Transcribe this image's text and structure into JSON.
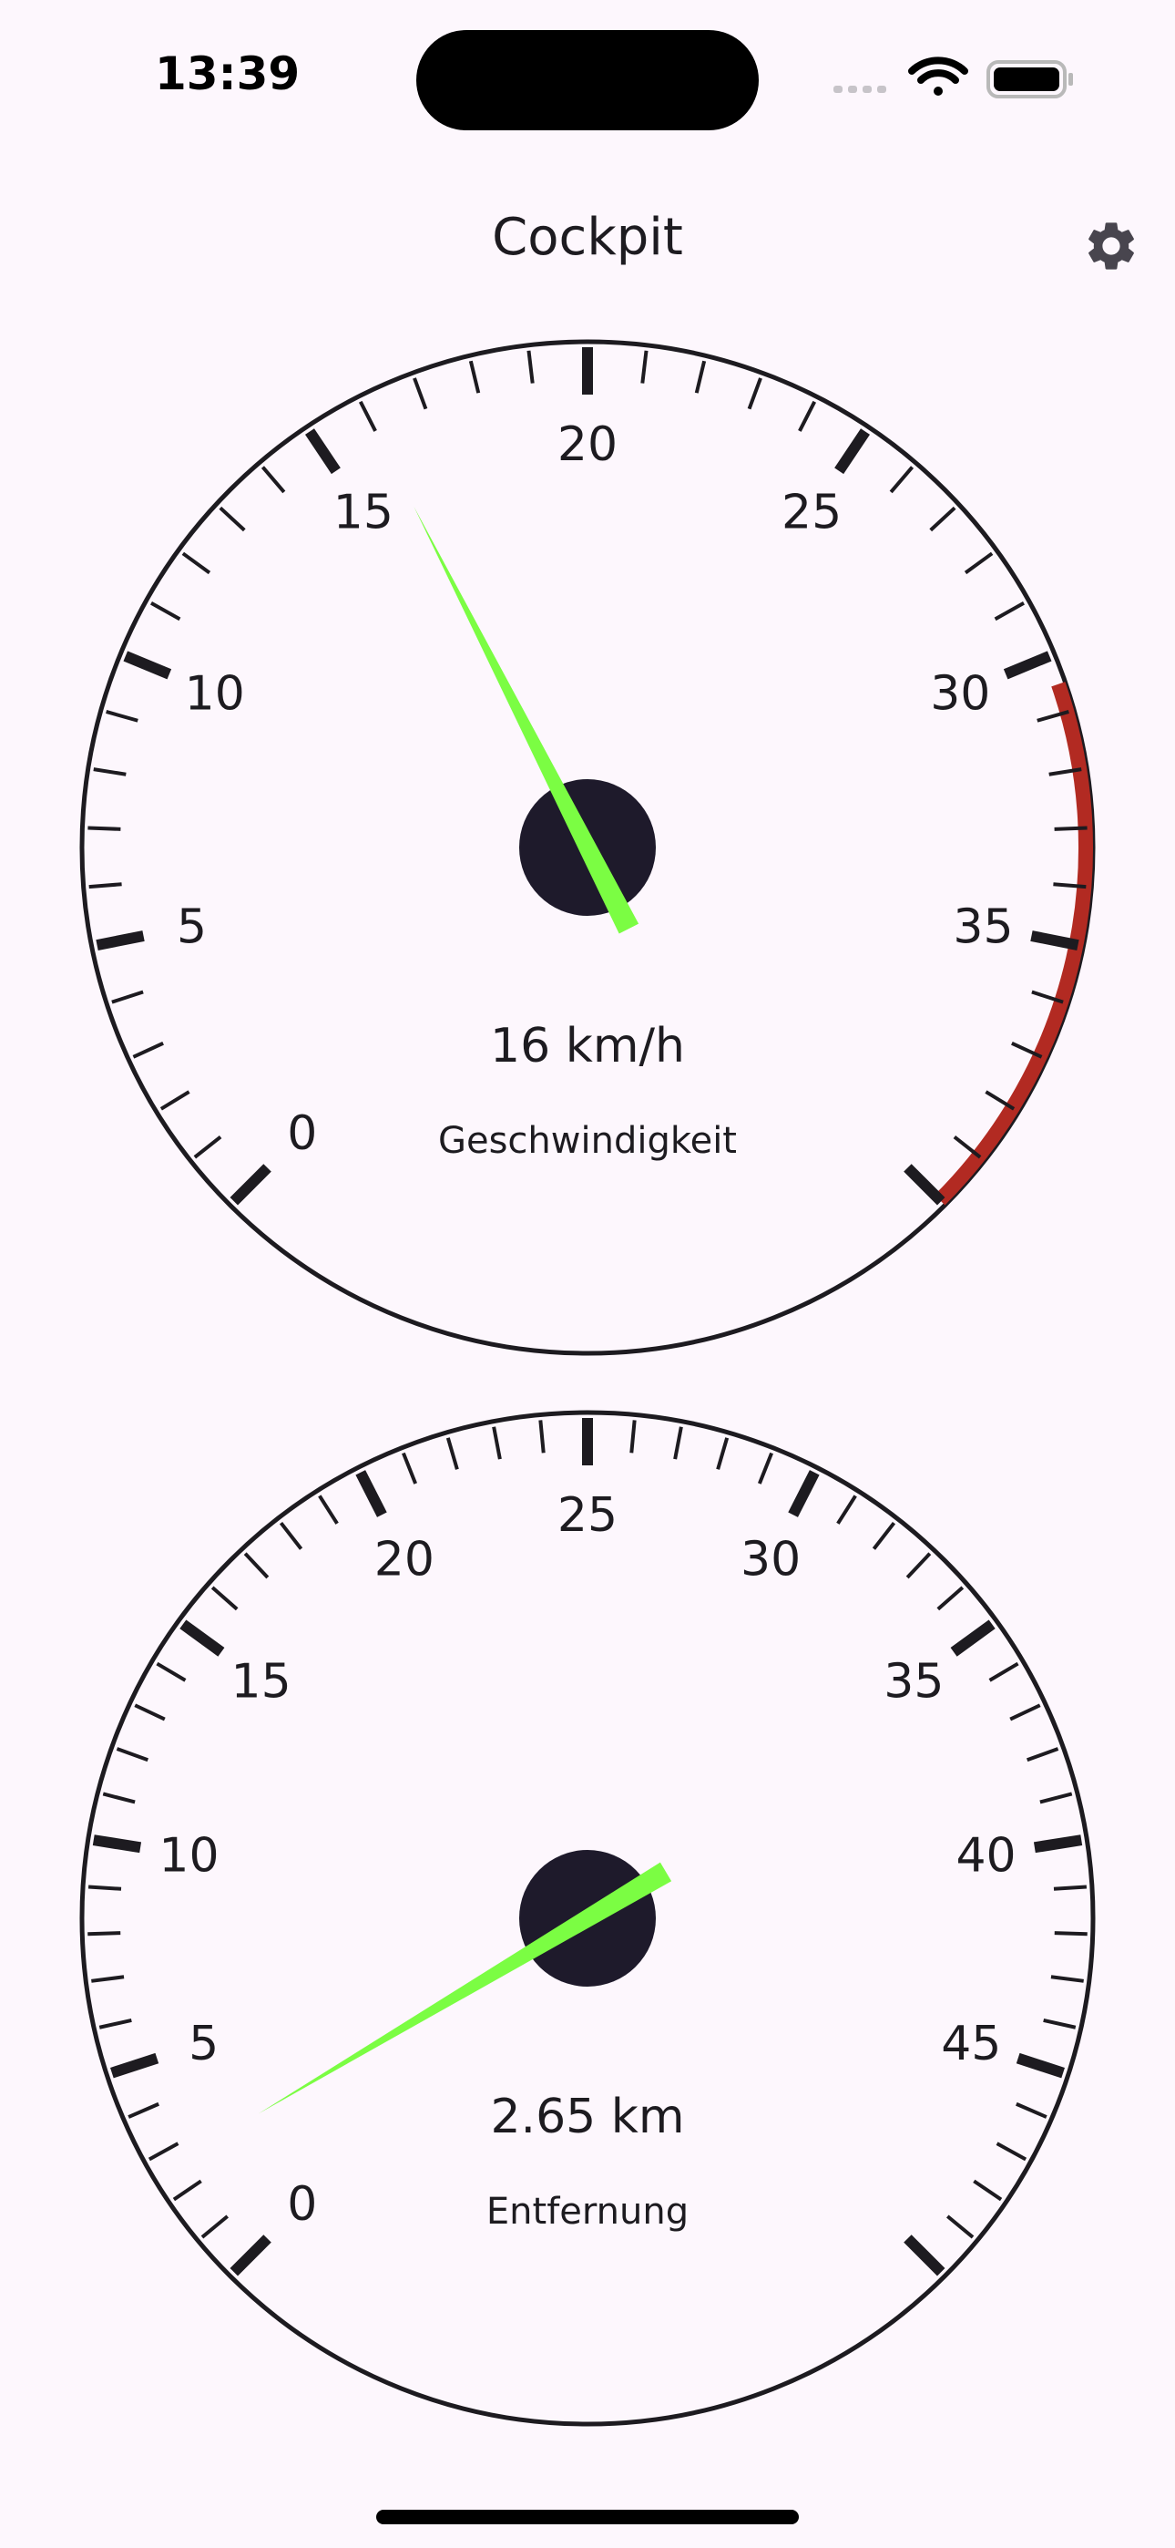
{
  "status_bar": {
    "time": "13:39",
    "icons": [
      "signal-icon",
      "wifi-icon",
      "battery-icon"
    ]
  },
  "app_bar": {
    "title": "Cockpit",
    "settings_icon": "gear-icon"
  },
  "gauges": [
    {
      "id": "speed",
      "value": 16,
      "value_text": "16 km/h",
      "label": "Geschwindigkeit",
      "min": 0,
      "max": 40,
      "major_step": 5,
      "minor_step": 1,
      "tick_labels": [
        "0",
        "5",
        "10",
        "15",
        "20",
        "25",
        "30",
        "35"
      ],
      "redline_from": 30.5,
      "redline_color": "#b22a22",
      "needle_color": "#7bfd43"
    },
    {
      "id": "distance",
      "value": 2.65,
      "value_text": "2.65 km",
      "label": "Entfernung",
      "min": 0,
      "max": 50,
      "major_step": 5,
      "minor_step": 1,
      "tick_labels": [
        "0",
        "5",
        "10",
        "15",
        "20",
        "25",
        "30",
        "35",
        "40",
        "45"
      ],
      "needle_color": "#7bfd43"
    }
  ],
  "colors": {
    "background": "#fdf7fd",
    "dial_ink": "#1d1b20",
    "hub": "#1e1a2b"
  }
}
